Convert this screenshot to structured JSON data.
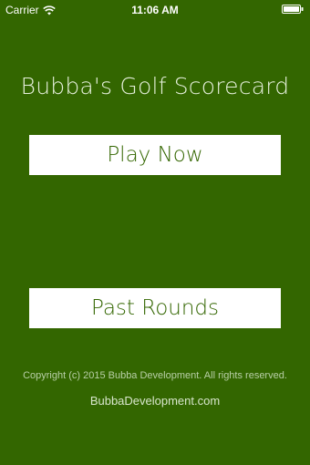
{
  "status_bar": {
    "carrier": "Carrier",
    "time": "11:06 AM",
    "wifi_icon": "wifi-icon",
    "battery_icon": "battery-full-icon"
  },
  "app": {
    "title": "Bubba's Golf Scorecard",
    "play_now_label": "Play Now",
    "past_rounds_label": "Past Rounds",
    "copyright": "Copyright (c) 2015 Bubba Development. All rights reserved.",
    "website": "BubbaDevelopment.com"
  },
  "colors": {
    "background": "#336600",
    "button_bg": "#ffffff",
    "button_text": "#336600"
  }
}
